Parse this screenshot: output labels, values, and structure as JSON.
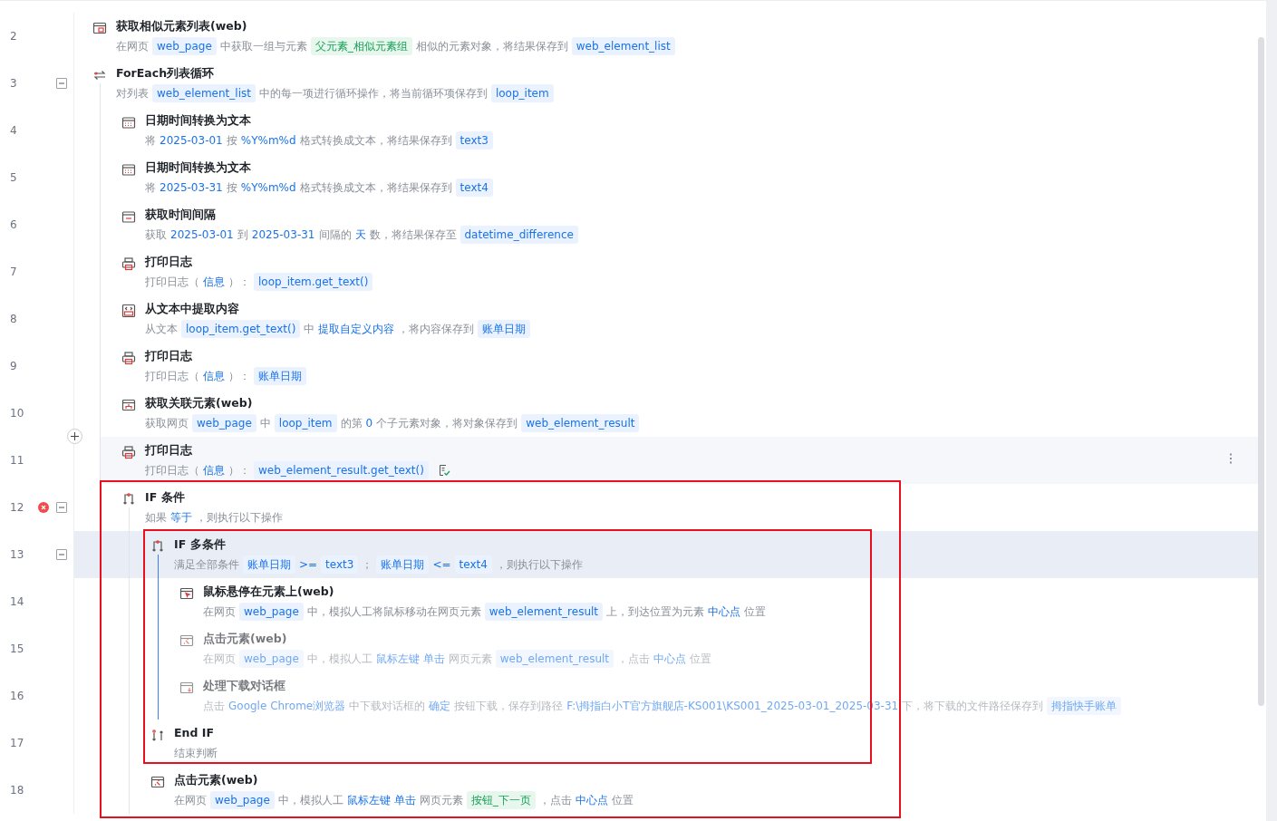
{
  "steps": [
    {
      "line": "2",
      "kind": "browser",
      "title": "获取相似元素列表(web)",
      "selected": false,
      "disabled": false,
      "desc": [
        {
          "kind": "text",
          "text": "在网页"
        },
        {
          "kind": "var",
          "text": "web_page"
        },
        {
          "kind": "text",
          "text": "中获取一组与元素"
        },
        {
          "kind": "elem",
          "text": "父元素_相似元素组"
        },
        {
          "kind": "text",
          "text": "相似的元素对象，将结果保存到"
        },
        {
          "kind": "var",
          "text": "web_element_list"
        }
      ]
    },
    {
      "line": "3",
      "kind": "loop",
      "title": "ForEach列表循环",
      "selected": false,
      "disabled": false,
      "expanded": true,
      "desc": [
        {
          "kind": "text",
          "text": "对列表"
        },
        {
          "kind": "var",
          "text": "web_element_list"
        },
        {
          "kind": "text",
          "text": "中的每一项进行循环操作，将当前循环项保存到"
        },
        {
          "kind": "var",
          "text": "loop_item"
        }
      ],
      "children": [
        {
          "line": "4",
          "kind": "calendar",
          "title": "日期时间转换为文本",
          "selected": false,
          "disabled": false,
          "desc": [
            {
              "kind": "text",
              "text": "将"
            },
            {
              "kind": "value",
              "text": "2025-03-01"
            },
            {
              "kind": "text",
              "text": "按"
            },
            {
              "kind": "value",
              "text": "%Y%m%d"
            },
            {
              "kind": "text",
              "text": "格式转换成文本，将结果保存到"
            },
            {
              "kind": "var",
              "text": "text3"
            }
          ]
        },
        {
          "line": "5",
          "kind": "calendar",
          "title": "日期时间转换为文本",
          "selected": false,
          "disabled": false,
          "desc": [
            {
              "kind": "text",
              "text": "将"
            },
            {
              "kind": "value",
              "text": "2025-03-31"
            },
            {
              "kind": "text",
              "text": "按"
            },
            {
              "kind": "value",
              "text": "%Y%m%d"
            },
            {
              "kind": "text",
              "text": "格式转换成文本，将结果保存到"
            },
            {
              "kind": "var",
              "text": "text4"
            }
          ]
        },
        {
          "line": "6",
          "kind": "interval",
          "title": "获取时间间隔",
          "selected": false,
          "disabled": false,
          "desc": [
            {
              "kind": "text",
              "text": "获取"
            },
            {
              "kind": "value",
              "text": "2025-03-01"
            },
            {
              "kind": "text",
              "text": "到"
            },
            {
              "kind": "value",
              "text": "2025-03-31"
            },
            {
              "kind": "text",
              "text": "间隔的"
            },
            {
              "kind": "value",
              "text": "天"
            },
            {
              "kind": "text",
              "text": "数，将结果保存至"
            },
            {
              "kind": "var",
              "text": "datetime_difference"
            }
          ]
        },
        {
          "line": "7",
          "kind": "print",
          "title": "打印日志",
          "selected": false,
          "disabled": false,
          "desc": [
            {
              "kind": "text",
              "text": "打印日志（"
            },
            {
              "kind": "value",
              "text": "信息"
            },
            {
              "kind": "text",
              "text": "）："
            },
            {
              "kind": "var",
              "text": "loop_item.get_text()"
            }
          ]
        },
        {
          "line": "8",
          "kind": "extract",
          "title": "从文本中提取内容",
          "selected": false,
          "disabled": false,
          "desc": [
            {
              "kind": "text",
              "text": "从文本"
            },
            {
              "kind": "var",
              "text": "loop_item.get_text()"
            },
            {
              "kind": "text",
              "text": "中"
            },
            {
              "kind": "value",
              "text": "提取自定义内容"
            },
            {
              "kind": "text",
              "text": "，将内容保存到"
            },
            {
              "kind": "var",
              "text": "账单日期"
            }
          ]
        },
        {
          "line": "9",
          "kind": "print",
          "title": "打印日志",
          "selected": false,
          "disabled": false,
          "desc": [
            {
              "kind": "text",
              "text": "打印日志（"
            },
            {
              "kind": "value",
              "text": "信息"
            },
            {
              "kind": "text",
              "text": "）："
            },
            {
              "kind": "var",
              "text": "账单日期"
            }
          ]
        },
        {
          "line": "10",
          "kind": "related",
          "title": "获取关联元素(web)",
          "selected": false,
          "disabled": false,
          "desc": [
            {
              "kind": "text",
              "text": "获取网页"
            },
            {
              "kind": "var",
              "text": "web_page"
            },
            {
              "kind": "text",
              "text": "中"
            },
            {
              "kind": "var",
              "text": "loop_item"
            },
            {
              "kind": "text",
              "text": "的第"
            },
            {
              "kind": "value",
              "text": "0"
            },
            {
              "kind": "text",
              "text": "个子元素对象，将对象保存到"
            },
            {
              "kind": "var",
              "text": "web_element_result"
            }
          ]
        },
        {
          "line": "11",
          "kind": "print",
          "title": "打印日志",
          "selected": false,
          "hovered": true,
          "disabled": false,
          "note": true,
          "desc": [
            {
              "kind": "text",
              "text": "打印日志（"
            },
            {
              "kind": "value",
              "text": "信息"
            },
            {
              "kind": "text",
              "text": "）："
            },
            {
              "kind": "var",
              "text": "web_element_result.get_text()"
            }
          ]
        },
        {
          "line": "12",
          "kind": "if",
          "title": "IF 条件",
          "selected": false,
          "disabled": false,
          "error": true,
          "expanded": true,
          "desc": [
            {
              "kind": "text",
              "text": "如果"
            },
            {
              "kind": "value",
              "text": "等于"
            },
            {
              "kind": "text",
              "text": "，则执行以下操作"
            }
          ],
          "children": [
            {
              "line": "13",
              "kind": "if",
              "title": "IF 多条件",
              "selected": true,
              "disabled": false,
              "expanded": true,
              "desc": [
                {
                  "kind": "text",
                  "text": "满足全部条件"
                },
                {
                  "kind": "var",
                  "text": "账单日期"
                },
                {
                  "kind": "value",
                  "text": ">="
                },
                {
                  "kind": "var",
                  "text": "text3"
                },
                {
                  "kind": "text",
                  "text": "；"
                },
                {
                  "kind": "var",
                  "text": "账单日期"
                },
                {
                  "kind": "value",
                  "text": "<="
                },
                {
                  "kind": "var",
                  "text": "text4"
                },
                {
                  "kind": "text",
                  "text": "，则执行以下操作"
                }
              ],
              "children": [
                {
                  "line": "14",
                  "kind": "hover",
                  "title": "鼠标悬停在元素上(web)",
                  "selected": false,
                  "disabled": false,
                  "desc": [
                    {
                      "kind": "text",
                      "text": "在网页"
                    },
                    {
                      "kind": "var",
                      "text": "web_page"
                    },
                    {
                      "kind": "text",
                      "text": "中，模拟人工将鼠标移动在网页元素"
                    },
                    {
                      "kind": "var",
                      "text": "web_element_result"
                    },
                    {
                      "kind": "text",
                      "text": "上，到达位置为元素"
                    },
                    {
                      "kind": "value",
                      "text": "中心点"
                    },
                    {
                      "kind": "text",
                      "text": "位置"
                    }
                  ]
                },
                {
                  "line": "15",
                  "kind": "click",
                  "title": "点击元素(web)",
                  "selected": false,
                  "disabled": true,
                  "desc": [
                    {
                      "kind": "text",
                      "text": "在网页"
                    },
                    {
                      "kind": "var",
                      "text": "web_page"
                    },
                    {
                      "kind": "text",
                      "text": "中，模拟人工"
                    },
                    {
                      "kind": "value",
                      "text": "鼠标左键"
                    },
                    {
                      "kind": "value",
                      "text": "单击"
                    },
                    {
                      "kind": "text",
                      "text": "网页元素"
                    },
                    {
                      "kind": "var",
                      "text": "web_element_result"
                    },
                    {
                      "kind": "text",
                      "text": "，点击"
                    },
                    {
                      "kind": "value",
                      "text": "中心点"
                    },
                    {
                      "kind": "text",
                      "text": "位置"
                    }
                  ]
                },
                {
                  "line": "16",
                  "kind": "download",
                  "title": "处理下载对话框",
                  "selected": false,
                  "disabled": true,
                  "desc": [
                    {
                      "kind": "text",
                      "text": "点击"
                    },
                    {
                      "kind": "value",
                      "text": "Google Chrome浏览器"
                    },
                    {
                      "kind": "text",
                      "text": "中下载对话框的"
                    },
                    {
                      "kind": "value",
                      "text": "确定"
                    },
                    {
                      "kind": "text",
                      "text": "按钮下载，保存到路径"
                    },
                    {
                      "kind": "value",
                      "text": "F:\\拇指白小T官方旗舰店-KS001\\KS001_2025-03-01_2025-03-31"
                    },
                    {
                      "kind": "text",
                      "text": "下，将下载的文件路径保存到"
                    },
                    {
                      "kind": "var",
                      "text": "拇指快手账单"
                    }
                  ]
                }
              ]
            },
            {
              "line": "17",
              "kind": "endif",
              "title": "End IF",
              "selected": false,
              "disabled": false,
              "desc": [
                {
                  "kind": "text",
                  "text": "结束判断"
                }
              ]
            },
            {
              "line": "18",
              "kind": "click",
              "title": "点击元素(web)",
              "selected": false,
              "disabled": false,
              "desc": [
                {
                  "kind": "text",
                  "text": "在网页"
                },
                {
                  "kind": "var",
                  "text": "web_page"
                },
                {
                  "kind": "text",
                  "text": "中，模拟人工"
                },
                {
                  "kind": "value",
                  "text": "鼠标左键"
                },
                {
                  "kind": "value",
                  "text": "单击"
                },
                {
                  "kind": "text",
                  "text": "网页元素"
                },
                {
                  "kind": "elem",
                  "text": "按钮_下一页"
                },
                {
                  "kind": "text",
                  "text": "，点击"
                },
                {
                  "kind": "value",
                  "text": "中心点"
                },
                {
                  "kind": "text",
                  "text": "位置"
                }
              ]
            }
          ]
        }
      ]
    }
  ],
  "markup_boxes": [
    {
      "kind": "box"
    },
    {
      "kind": "box"
    }
  ]
}
